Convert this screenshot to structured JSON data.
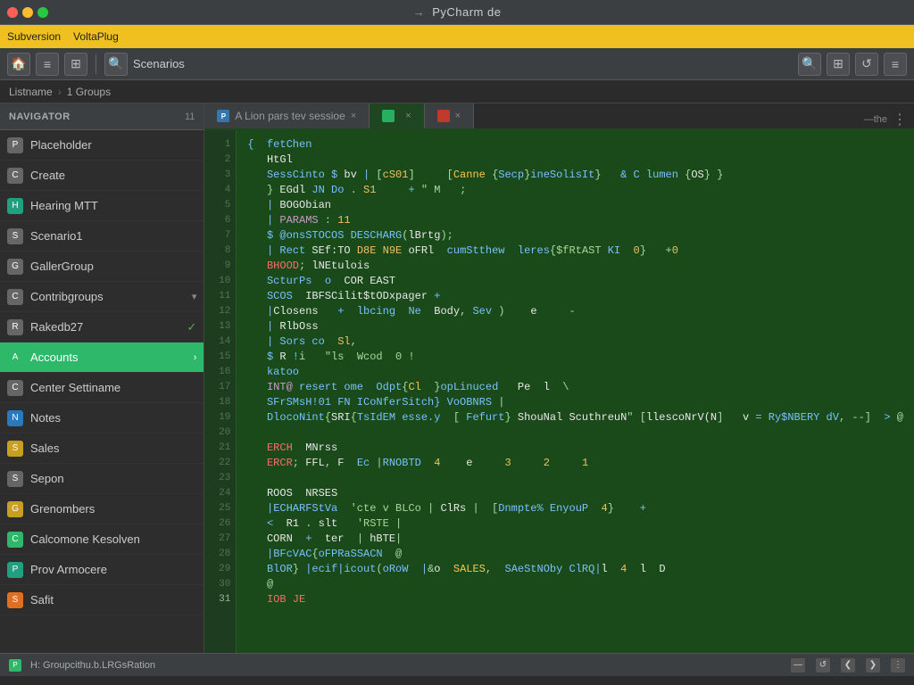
{
  "window": {
    "title": "PyCharm",
    "title_arrow": "→",
    "title_full": "PyCharm de"
  },
  "traffic_lights": {
    "red": "⬤",
    "yellow": "⬤",
    "green": "⬤"
  },
  "menubar": {
    "items": [
      "Subversion",
      "VoltaPlug"
    ]
  },
  "toolbar": {
    "buttons": [
      "🏠",
      "≡",
      "⚙",
      "▶",
      "⬛"
    ],
    "right_buttons": [
      "🔍",
      "⊞",
      "↺",
      "≡"
    ],
    "search_label": "Scenarios"
  },
  "breadcrumb": {
    "items": [
      "Listname",
      "1 Groups"
    ]
  },
  "sidebar": {
    "header": "Navigator",
    "header_count": "11",
    "items": [
      {
        "id": "item1",
        "label": "Placeholder",
        "icon": "gray",
        "icon_text": "P",
        "has_arrow": false,
        "checked": false
      },
      {
        "id": "item2",
        "label": "Create",
        "icon": "gray",
        "icon_text": "C",
        "has_arrow": false,
        "checked": false
      },
      {
        "id": "item3",
        "label": "Hearing MTT",
        "icon": "teal",
        "icon_text": "H",
        "has_arrow": false,
        "checked": false
      },
      {
        "id": "item4",
        "label": "Scenario1",
        "icon": "gray",
        "icon_text": "S",
        "has_arrow": false,
        "checked": false
      },
      {
        "id": "item5",
        "label": "GallerGroup",
        "icon": "gray",
        "icon_text": "G",
        "has_arrow": false,
        "checked": false
      },
      {
        "id": "item6",
        "label": "Contribgroups",
        "icon": "gray",
        "icon_text": "C",
        "has_arrow": true,
        "checked": false
      },
      {
        "id": "item7",
        "label": "Rakedb27",
        "icon": "gray",
        "icon_text": "R",
        "has_arrow": false,
        "checked": true
      },
      {
        "id": "item8",
        "label": "Accounts",
        "icon": "green",
        "icon_text": "A",
        "has_arrow": true,
        "checked": false,
        "active": true
      },
      {
        "id": "item9",
        "label": "Center Settiname",
        "icon": "gray",
        "icon_text": "C",
        "has_arrow": false,
        "checked": false
      },
      {
        "id": "item10",
        "label": "Notes",
        "icon": "blue",
        "icon_text": "N",
        "has_arrow": false,
        "checked": false
      },
      {
        "id": "item11",
        "label": "Sales",
        "icon": "yellow",
        "icon_text": "S",
        "has_arrow": false,
        "checked": false
      },
      {
        "id": "item12",
        "label": "Sepon",
        "icon": "gray",
        "icon_text": "S",
        "has_arrow": false,
        "checked": false
      },
      {
        "id": "item13",
        "label": "Grenombers",
        "icon": "yellow",
        "icon_text": "G",
        "has_arrow": false,
        "checked": false
      },
      {
        "id": "item14",
        "label": "Calcomone Kesolven",
        "icon": "green",
        "icon_text": "C",
        "has_arrow": false,
        "checked": false
      },
      {
        "id": "item15",
        "label": "Prov Armocere",
        "icon": "teal",
        "icon_text": "P",
        "has_arrow": false,
        "checked": false
      },
      {
        "id": "item16",
        "label": "Safit",
        "icon": "orange",
        "icon_text": "S",
        "has_arrow": false,
        "checked": false
      }
    ]
  },
  "editor": {
    "tabs": [
      {
        "id": "tab1",
        "label": "A Lion pars tev sessioe",
        "active": false,
        "icon_type": "py"
      },
      {
        "id": "tab2",
        "label": "",
        "active": true,
        "icon_type": "green"
      },
      {
        "id": "tab3",
        "label": "",
        "active": false,
        "icon_type": "red"
      }
    ],
    "breadcrumb": "Listname > 1Groups",
    "filename": "Groupcithu.b.LRGsRation",
    "code_lines": [
      {
        "num": 1,
        "text": "{  fetChen"
      },
      {
        "num": 2,
        "text": "   HtGl"
      },
      {
        "num": 3,
        "text": "   SessCinto $ bv | [cS01]     [Canne {Secp}ineSolisIt}   & C lumen {OS} }"
      },
      {
        "num": 4,
        "text": "   } EGdl JN Do . S1     + \" M   ;"
      },
      {
        "num": 5,
        "text": "   | BOGObian"
      },
      {
        "num": 6,
        "text": "   | PARAMS : 11"
      },
      {
        "num": 7,
        "text": "   $ @onsSTOCOS DESCHARG(lBrtg);"
      },
      {
        "num": 8,
        "text": "   | Rect SEf:TO D8E N9E oFRl  cumStthew  leres{$fRtAST KI  0}   +0"
      },
      {
        "num": 9,
        "text": "   BHOOD; lNEtulois"
      },
      {
        "num": 10,
        "text": "   ScturPs  o  COR EAST"
      },
      {
        "num": 11,
        "text": "   SCOS  IBFSCilit$tODxpager +"
      },
      {
        "num": 12,
        "text": "   |Closens   +  lbcing  Ne  Body, Sev )    e     -"
      },
      {
        "num": 13,
        "text": "   | RlbOss"
      },
      {
        "num": 14,
        "text": "   | Sors co  Sl,"
      },
      {
        "num": 15,
        "text": "   $ R !i   \"ls  Wcod  0 !"
      },
      {
        "num": 16,
        "text": "   katoo"
      },
      {
        "num": 17,
        "text": "   INT@ resert ome  Odpt{Cl  }opLinuced   Pe  l  \\"
      },
      {
        "num": 18,
        "text": "   SFrSMsH!01 FN ICoNferSitch} VoOBNRS |"
      },
      {
        "num": 19,
        "text": "   DlocoNint{SRI{TsIdEM esse.y  [ Fefurt} ShouNal ScuthreuN\" [llescoNrV(N]   v = Ry$NBERY dV, --]  > @"
      },
      {
        "num": 20,
        "text": "   "
      },
      {
        "num": 21,
        "text": "   ERCH  MNrss"
      },
      {
        "num": 22,
        "text": "   ERCR; FFL, F  Ec |RNOBTD  4    e     3     2     1"
      },
      {
        "num": 23,
        "text": "   "
      },
      {
        "num": 24,
        "text": "   ROOS  NRSES"
      },
      {
        "num": 25,
        "text": "   |ECHARFStVa  'cte v BLCo | ClRs |  [Dnmpte% EnyouP  4}    +"
      },
      {
        "num": 26,
        "text": "   <  R1 . slt   'RSTE |"
      },
      {
        "num": 27,
        "text": "   CORN  +  ter  | hBTE|"
      },
      {
        "num": 28,
        "text": "   |BFcVAC{oFPRaSSACN  @"
      },
      {
        "num": 29,
        "text": "   BlOR} |ecif|icout(oRoW  |&o  SALES,  SAeStNOby ClRQ|l  4  l  D"
      },
      {
        "num": 30,
        "text": "   @"
      },
      {
        "num": 31,
        "text": "   IOB JE"
      }
    ]
  },
  "statusbar": {
    "icon_text": "P",
    "left_text": "H:  Groupcithu.b.LRGsRation",
    "right_buttons": [
      "—",
      "↺",
      "❮",
      "❯",
      "⋮"
    ]
  },
  "colors": {
    "editor_bg": "#1a4a1a",
    "sidebar_bg": "#2d2d2d",
    "active_tab": "#2979bf",
    "active_sidebar": "#2eb86a",
    "titlebar_bg": "#3c3f41",
    "menubar_bg": "#f0c020"
  }
}
